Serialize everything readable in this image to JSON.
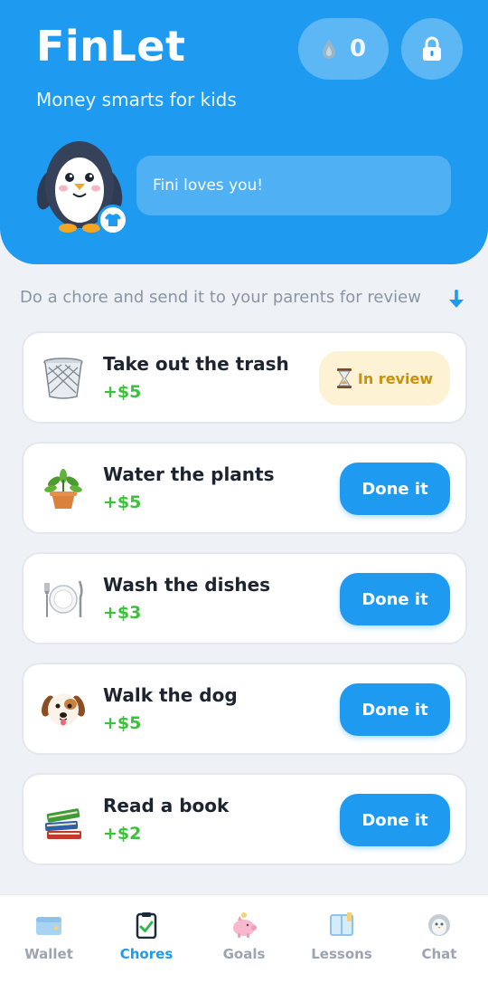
{
  "header": {
    "title": "FinLet",
    "subtitle": "Money smarts for kids",
    "coins": "0",
    "mascot_message": "Fini loves you!"
  },
  "instruction": "Do a chore and send it to your parents for review",
  "chores": [
    {
      "name": "Take out the trash",
      "reward": "+$5",
      "icon": "wastebasket-icon",
      "status": "In review"
    },
    {
      "name": "Water the plants",
      "reward": "+$5",
      "icon": "potted-plant-icon",
      "action": "Done it"
    },
    {
      "name": "Wash the dishes",
      "reward": "+$3",
      "icon": "plate-cutlery-icon",
      "action": "Done it"
    },
    {
      "name": "Walk the dog",
      "reward": "+$5",
      "icon": "dog-face-icon",
      "action": "Done it"
    },
    {
      "name": "Read a book",
      "reward": "+$2",
      "icon": "books-icon",
      "action": "Done it"
    }
  ],
  "nav": [
    {
      "label": "Wallet",
      "icon": "wallet-icon",
      "active": false
    },
    {
      "label": "Chores",
      "icon": "clipboard-check-icon",
      "active": true
    },
    {
      "label": "Goals",
      "icon": "piggy-bank-icon",
      "active": false
    },
    {
      "label": "Lessons",
      "icon": "book-icon",
      "active": false
    },
    {
      "label": "Chat",
      "icon": "mascot-chat-icon",
      "active": false
    }
  ],
  "colors": {
    "primary": "#1e9bf0",
    "reward_green": "#3cc13b",
    "review_bg": "#fdf2d3",
    "review_text": "#c9920c"
  }
}
